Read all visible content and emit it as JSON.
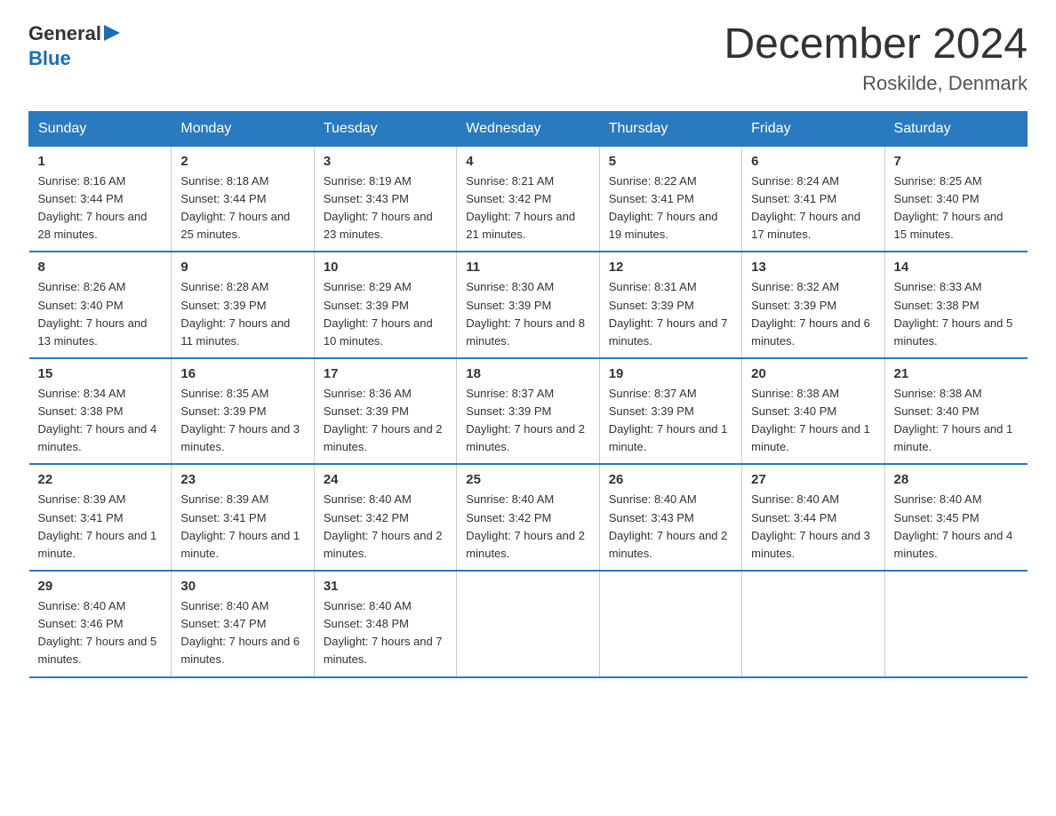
{
  "logo": {
    "general": "General",
    "arrow": "▶",
    "blue": "Blue"
  },
  "title": "December 2024",
  "location": "Roskilde, Denmark",
  "days_of_week": [
    "Sunday",
    "Monday",
    "Tuesday",
    "Wednesday",
    "Thursday",
    "Friday",
    "Saturday"
  ],
  "weeks": [
    [
      {
        "num": "1",
        "sunrise": "8:16 AM",
        "sunset": "3:44 PM",
        "daylight": "7 hours and 28 minutes."
      },
      {
        "num": "2",
        "sunrise": "8:18 AM",
        "sunset": "3:44 PM",
        "daylight": "7 hours and 25 minutes."
      },
      {
        "num": "3",
        "sunrise": "8:19 AM",
        "sunset": "3:43 PM",
        "daylight": "7 hours and 23 minutes."
      },
      {
        "num": "4",
        "sunrise": "8:21 AM",
        "sunset": "3:42 PM",
        "daylight": "7 hours and 21 minutes."
      },
      {
        "num": "5",
        "sunrise": "8:22 AM",
        "sunset": "3:41 PM",
        "daylight": "7 hours and 19 minutes."
      },
      {
        "num": "6",
        "sunrise": "8:24 AM",
        "sunset": "3:41 PM",
        "daylight": "7 hours and 17 minutes."
      },
      {
        "num": "7",
        "sunrise": "8:25 AM",
        "sunset": "3:40 PM",
        "daylight": "7 hours and 15 minutes."
      }
    ],
    [
      {
        "num": "8",
        "sunrise": "8:26 AM",
        "sunset": "3:40 PM",
        "daylight": "7 hours and 13 minutes."
      },
      {
        "num": "9",
        "sunrise": "8:28 AM",
        "sunset": "3:39 PM",
        "daylight": "7 hours and 11 minutes."
      },
      {
        "num": "10",
        "sunrise": "8:29 AM",
        "sunset": "3:39 PM",
        "daylight": "7 hours and 10 minutes."
      },
      {
        "num": "11",
        "sunrise": "8:30 AM",
        "sunset": "3:39 PM",
        "daylight": "7 hours and 8 minutes."
      },
      {
        "num": "12",
        "sunrise": "8:31 AM",
        "sunset": "3:39 PM",
        "daylight": "7 hours and 7 minutes."
      },
      {
        "num": "13",
        "sunrise": "8:32 AM",
        "sunset": "3:39 PM",
        "daylight": "7 hours and 6 minutes."
      },
      {
        "num": "14",
        "sunrise": "8:33 AM",
        "sunset": "3:38 PM",
        "daylight": "7 hours and 5 minutes."
      }
    ],
    [
      {
        "num": "15",
        "sunrise": "8:34 AM",
        "sunset": "3:38 PM",
        "daylight": "7 hours and 4 minutes."
      },
      {
        "num": "16",
        "sunrise": "8:35 AM",
        "sunset": "3:39 PM",
        "daylight": "7 hours and 3 minutes."
      },
      {
        "num": "17",
        "sunrise": "8:36 AM",
        "sunset": "3:39 PM",
        "daylight": "7 hours and 2 minutes."
      },
      {
        "num": "18",
        "sunrise": "8:37 AM",
        "sunset": "3:39 PM",
        "daylight": "7 hours and 2 minutes."
      },
      {
        "num": "19",
        "sunrise": "8:37 AM",
        "sunset": "3:39 PM",
        "daylight": "7 hours and 1 minute."
      },
      {
        "num": "20",
        "sunrise": "8:38 AM",
        "sunset": "3:40 PM",
        "daylight": "7 hours and 1 minute."
      },
      {
        "num": "21",
        "sunrise": "8:38 AM",
        "sunset": "3:40 PM",
        "daylight": "7 hours and 1 minute."
      }
    ],
    [
      {
        "num": "22",
        "sunrise": "8:39 AM",
        "sunset": "3:41 PM",
        "daylight": "7 hours and 1 minute."
      },
      {
        "num": "23",
        "sunrise": "8:39 AM",
        "sunset": "3:41 PM",
        "daylight": "7 hours and 1 minute."
      },
      {
        "num": "24",
        "sunrise": "8:40 AM",
        "sunset": "3:42 PM",
        "daylight": "7 hours and 2 minutes."
      },
      {
        "num": "25",
        "sunrise": "8:40 AM",
        "sunset": "3:42 PM",
        "daylight": "7 hours and 2 minutes."
      },
      {
        "num": "26",
        "sunrise": "8:40 AM",
        "sunset": "3:43 PM",
        "daylight": "7 hours and 2 minutes."
      },
      {
        "num": "27",
        "sunrise": "8:40 AM",
        "sunset": "3:44 PM",
        "daylight": "7 hours and 3 minutes."
      },
      {
        "num": "28",
        "sunrise": "8:40 AM",
        "sunset": "3:45 PM",
        "daylight": "7 hours and 4 minutes."
      }
    ],
    [
      {
        "num": "29",
        "sunrise": "8:40 AM",
        "sunset": "3:46 PM",
        "daylight": "7 hours and 5 minutes."
      },
      {
        "num": "30",
        "sunrise": "8:40 AM",
        "sunset": "3:47 PM",
        "daylight": "7 hours and 6 minutes."
      },
      {
        "num": "31",
        "sunrise": "8:40 AM",
        "sunset": "3:48 PM",
        "daylight": "7 hours and 7 minutes."
      },
      null,
      null,
      null,
      null
    ]
  ]
}
